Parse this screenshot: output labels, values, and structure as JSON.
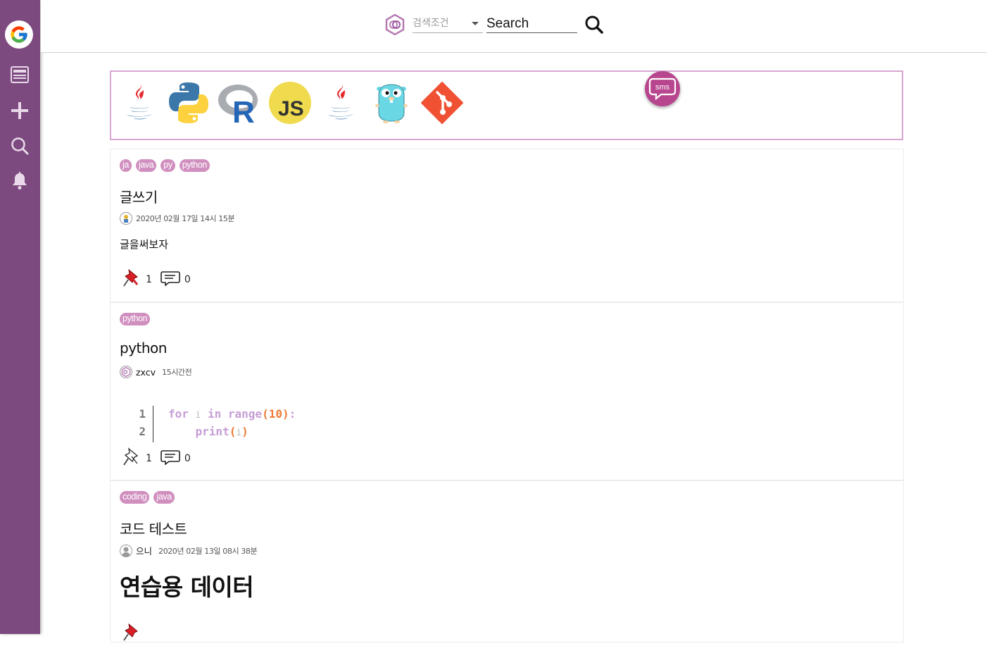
{
  "header": {
    "search_condition_placeholder": "검색조건",
    "search_placeholder": "Search"
  },
  "sidebar": {
    "items": [
      {
        "icon": "google-icon",
        "name": "home"
      },
      {
        "icon": "board-icon",
        "name": "board"
      },
      {
        "icon": "plus-icon",
        "name": "write"
      },
      {
        "icon": "search-icon",
        "name": "search"
      },
      {
        "icon": "bell-icon",
        "name": "notifications"
      }
    ]
  },
  "language_bar": {
    "icons": [
      "java-icon",
      "python-icon",
      "r-icon",
      "js-icon",
      "java-icon",
      "go-gopher-icon",
      "git-icon"
    ],
    "js_label": "JS",
    "r_label": "R"
  },
  "chat_button": {
    "label": "sms"
  },
  "posts": [
    {
      "tags": [
        "ja",
        "java",
        "py",
        "python"
      ],
      "title": "글쓰기",
      "author": "",
      "date": "2020년 02월 17일 14시 15분",
      "content": "글을써보자",
      "pin_count": "1",
      "comment_count": "0",
      "pinned": true
    },
    {
      "tags": [
        "python"
      ],
      "title": "python",
      "author": "zxcv",
      "date": "15시간전",
      "code_lines": [
        {
          "num": "1",
          "tokens": [
            [
              "kw",
              "for "
            ],
            [
              "vr",
              "i"
            ],
            [
              "kw",
              " in "
            ],
            [
              "kw",
              "range"
            ],
            [
              "pn",
              "(10)"
            ],
            [
              "kw",
              ":"
            ]
          ]
        },
        {
          "num": "2",
          "tokens": [
            [
              "kw",
              "    print"
            ],
            [
              "pn",
              "("
            ],
            [
              "vr",
              "i"
            ],
            [
              "pn",
              ")"
            ]
          ]
        }
      ],
      "pin_count": "1",
      "comment_count": "0",
      "pinned": false
    },
    {
      "tags": [
        "coding",
        "java"
      ],
      "title": "코드 테스트",
      "author": "으니",
      "date": "2020년 02월 13일 08시 38분",
      "content": "연습용 데이터",
      "pinned": true
    }
  ],
  "colors": {
    "sidebar": "#7d4a7f",
    "accent": "#b8468f",
    "tag": "#d08fbf",
    "iconbar_border": "#d9a6d3"
  }
}
